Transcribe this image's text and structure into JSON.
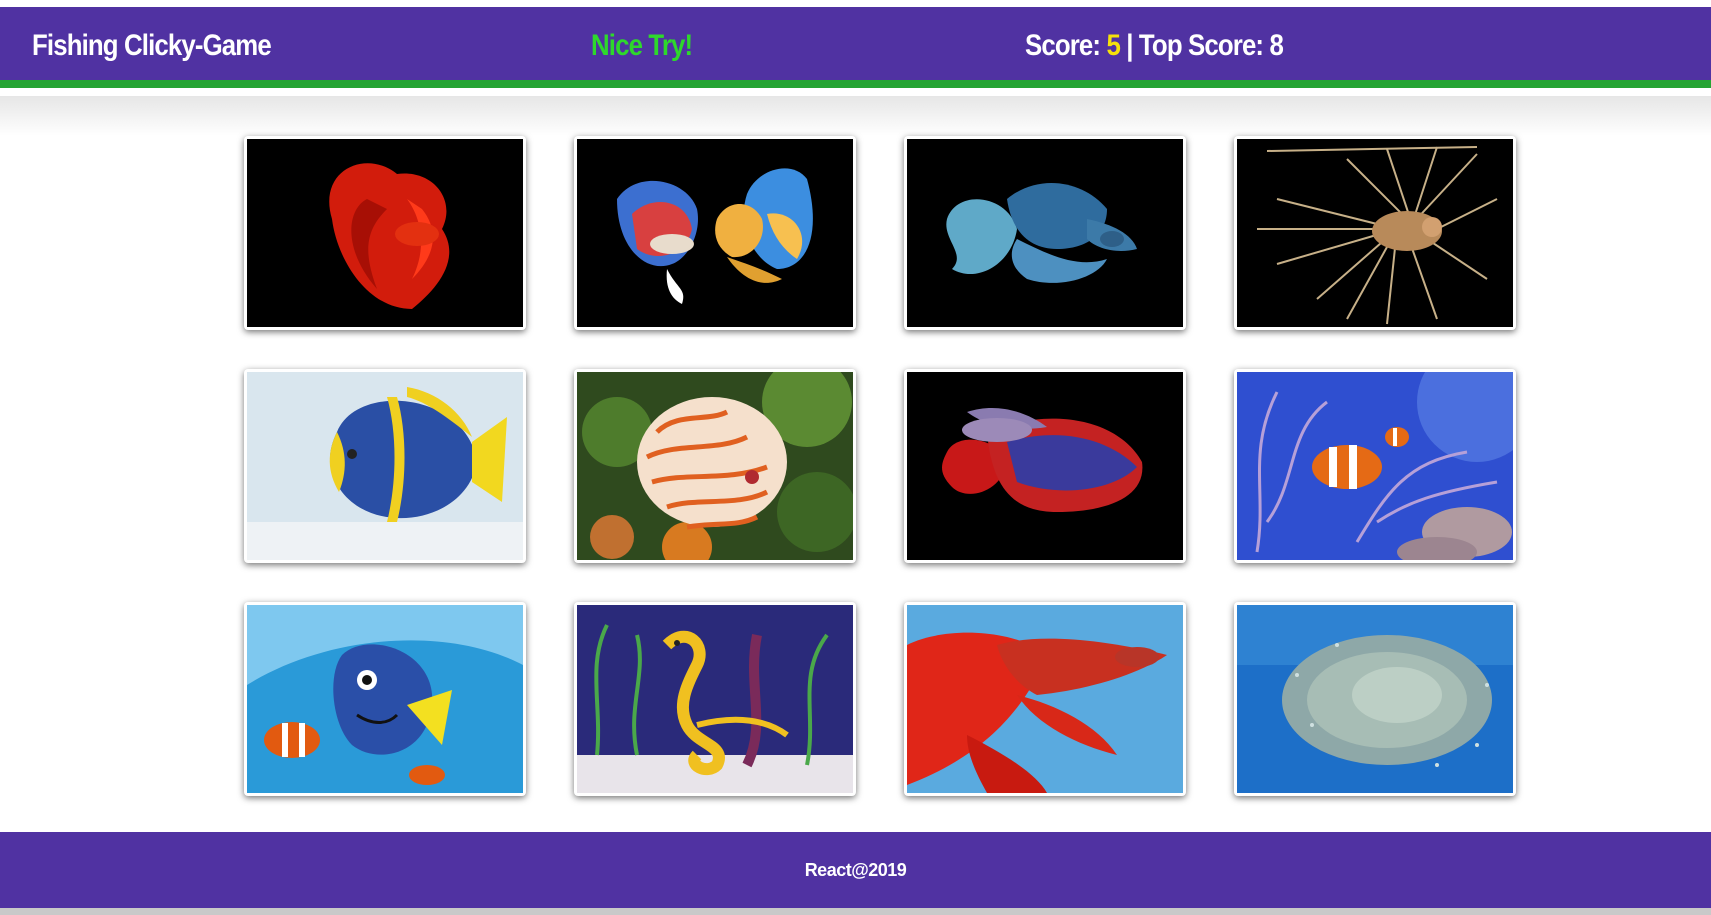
{
  "navbar": {
    "title": "Fishing Clicky-Game",
    "message": "Nice Try!",
    "score_label": "Score: ",
    "score_value": "5",
    "separator": " | ",
    "top_score_label": "Top Score: ",
    "top_score_value": "8"
  },
  "cards": [
    {
      "name": "red-betta-fish-card"
    },
    {
      "name": "two-betta-fish-card"
    },
    {
      "name": "blue-betta-fish-card"
    },
    {
      "name": "lionfish-card"
    },
    {
      "name": "blue-yellow-angelfish-card"
    },
    {
      "name": "discus-fish-card"
    },
    {
      "name": "red-blue-betta-fish-card"
    },
    {
      "name": "clownfish-card"
    },
    {
      "name": "dory-nemo-card"
    },
    {
      "name": "seahorse-card"
    },
    {
      "name": "red-betta-blue-background-card"
    },
    {
      "name": "fish-school-card"
    }
  ],
  "footer": {
    "text": "React@2019"
  },
  "colors": {
    "navbar_bg": "#5032a2",
    "navbar_border": "#26a434",
    "message": "#2ed82c",
    "score_value": "#f5e10b",
    "text": "#ffffff"
  }
}
